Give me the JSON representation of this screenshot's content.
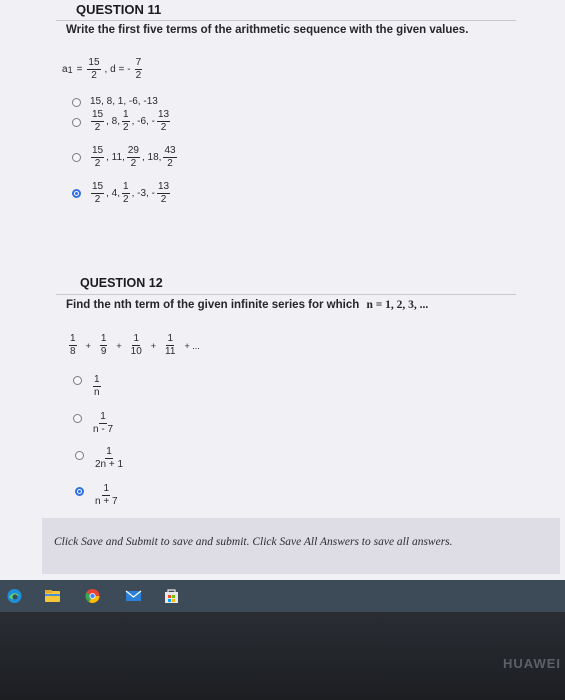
{
  "question11": {
    "title": "QUESTION 11",
    "prompt": "Write the first five terms of the arithmetic sequence with the given values.",
    "given": {
      "a_label": "a",
      "a_sub": "1",
      "eq": "=",
      "a_num": "15",
      "a_den": "2",
      "d_label": ", d =",
      "d_sign": "-",
      "d_num": "7",
      "d_den": "2"
    },
    "options": [
      {
        "text": "15, 8, 1, -6, -13",
        "selected": false
      },
      {
        "selected": false,
        "parts": {
          "f1n": "15",
          "f1d": "2",
          "t1": ", 8,",
          "f2n": "1",
          "f2d": "2",
          "t2": ", -6, -",
          "f3n": "13",
          "f3d": "2"
        }
      },
      {
        "selected": false,
        "parts": {
          "f1n": "15",
          "f1d": "2",
          "t1": ", 11,",
          "f2n": "29",
          "f2d": "2",
          "t2": ", 18,",
          "f3n": "43",
          "f3d": "2"
        }
      },
      {
        "selected": true,
        "parts": {
          "f1n": "15",
          "f1d": "2",
          "t1": ", 4,",
          "f2n": "1",
          "f2d": "2",
          "t2": ", -3, -",
          "f3n": "13",
          "f3d": "2"
        }
      }
    ]
  },
  "question12": {
    "title": "QUESTION 12",
    "prompt": "Find the nth term of the given infinite series for which",
    "prompt_values": "n = 1, 2, 3, ...",
    "series": {
      "n1": "1",
      "d1": "8",
      "n2": "1",
      "d2": "9",
      "n3": "1",
      "d3": "10",
      "n4": "1",
      "d4": "11",
      "plus": "+",
      "ellipsis": "+ ..."
    },
    "options": [
      {
        "num": "1",
        "den": "n",
        "selected": false
      },
      {
        "num": "1",
        "den": "n - 7",
        "selected": false
      },
      {
        "num": "1",
        "den": "2n + 1",
        "selected": false
      },
      {
        "num": "1",
        "den": "n + 7",
        "selected": true
      }
    ]
  },
  "footer": {
    "text": "Click Save and Submit to save and submit. Click Save All Answers to save all answers."
  },
  "taskbar": {
    "icons": [
      "edge-icon",
      "file-explorer-icon",
      "chrome-icon",
      "mail-icon",
      "store-icon"
    ]
  },
  "device": {
    "brand": "HUAWEI"
  },
  "colors": {
    "accent": "#2f6fe6",
    "taskbar": "#3c4b57"
  }
}
